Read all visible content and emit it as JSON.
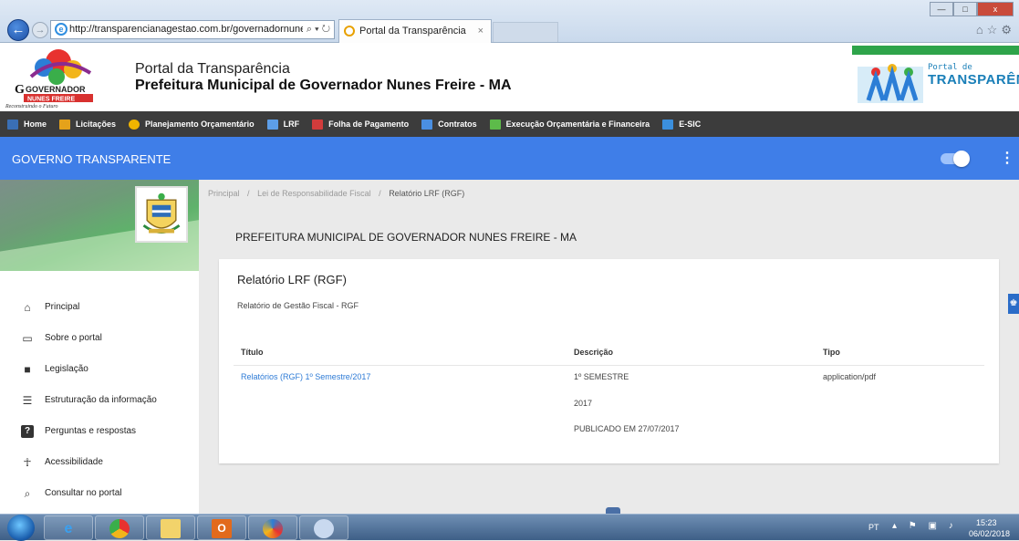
{
  "browser": {
    "url": "http://transparencianagestao.com.br/governadornune",
    "url_tools": "⌕ ▾ ↻",
    "tab_active_title": "Portal da Transparência",
    "tab_close": "×"
  },
  "header": {
    "title": "Portal da Transparência",
    "subtitle": "Prefeitura Municipal de Governador Nunes Freire - MA",
    "logo_text_top": "GOVERNADOR",
    "logo_text_bottom": "NUNES FREIRE",
    "logo_tagline": "Reconstruindo o Futuro",
    "brand_small": "Portal de",
    "brand_big": "TRANSPARÊNCIA"
  },
  "nav": {
    "items": [
      {
        "label": "Home",
        "icon": "home-icon",
        "color": "#3a6fb5"
      },
      {
        "label": "Licitações",
        "icon": "folder-icon",
        "color": "#e5a21a"
      },
      {
        "label": "Planejamento Orçamentário",
        "icon": "moneybag-icon",
        "color": "#f0b400"
      },
      {
        "label": "LRF",
        "icon": "document-stack-icon",
        "color": "#5d9ee8"
      },
      {
        "label": "Folha de Pagamento",
        "icon": "calendar-icon",
        "color": "#d23c3c"
      },
      {
        "label": "Contratos",
        "icon": "contract-icon",
        "color": "#4a8fe2"
      },
      {
        "label": "Execução Orçamentária e Financeira",
        "icon": "chart-up-icon",
        "color": "#5dbb4a"
      },
      {
        "label": "E-SIC",
        "icon": "people-icon",
        "color": "#3b8fdd"
      }
    ]
  },
  "appbar": {
    "title": "GOVERNO TRANSPARENTE",
    "menu_glyph": "⋮"
  },
  "sidebar": {
    "items": [
      {
        "label": "Principal",
        "glyph": "⌂"
      },
      {
        "label": "Sobre o portal",
        "glyph": "▭"
      },
      {
        "label": "Legislação",
        "glyph": "■"
      },
      {
        "label": "Estruturação da informação",
        "glyph": "☰"
      },
      {
        "label": "Perguntas e respostas",
        "glyph": "?"
      },
      {
        "label": "Acessibilidade",
        "glyph": "☥"
      },
      {
        "label": "Consultar no portal",
        "glyph": "⌕"
      }
    ]
  },
  "breadcrumb": {
    "items": [
      "Principal",
      "Lei de Responsabilidade Fiscal",
      "Relatório LRF (RGF)"
    ],
    "separator": "/"
  },
  "main": {
    "org_title": "PREFEITURA MUNICIPAL DE GOVERNADOR NUNES FREIRE - MA",
    "card_title": "Relatório LRF (RGF)",
    "card_subtitle": "Relatório de Gestão Fiscal - RGF",
    "table": {
      "headers": [
        "Título",
        "Descrição",
        "Tipo"
      ],
      "row": {
        "title": "Relatórios (RGF) 1º Semestre/2017",
        "description_lines": [
          "1º SEMESTRE",
          "2017",
          "PUBLICADO EM 27/07/2017"
        ],
        "type": "application/pdf"
      }
    }
  },
  "taskbar": {
    "lang": "PT",
    "tray": "▴ ⚑ ▣ ♪",
    "time": "15:23",
    "date": "06/02/2018"
  },
  "colors": {
    "appbar_blue": "#3f7ee8",
    "nav_dark": "#3c3c3c",
    "link_blue": "#2e7bd6"
  }
}
